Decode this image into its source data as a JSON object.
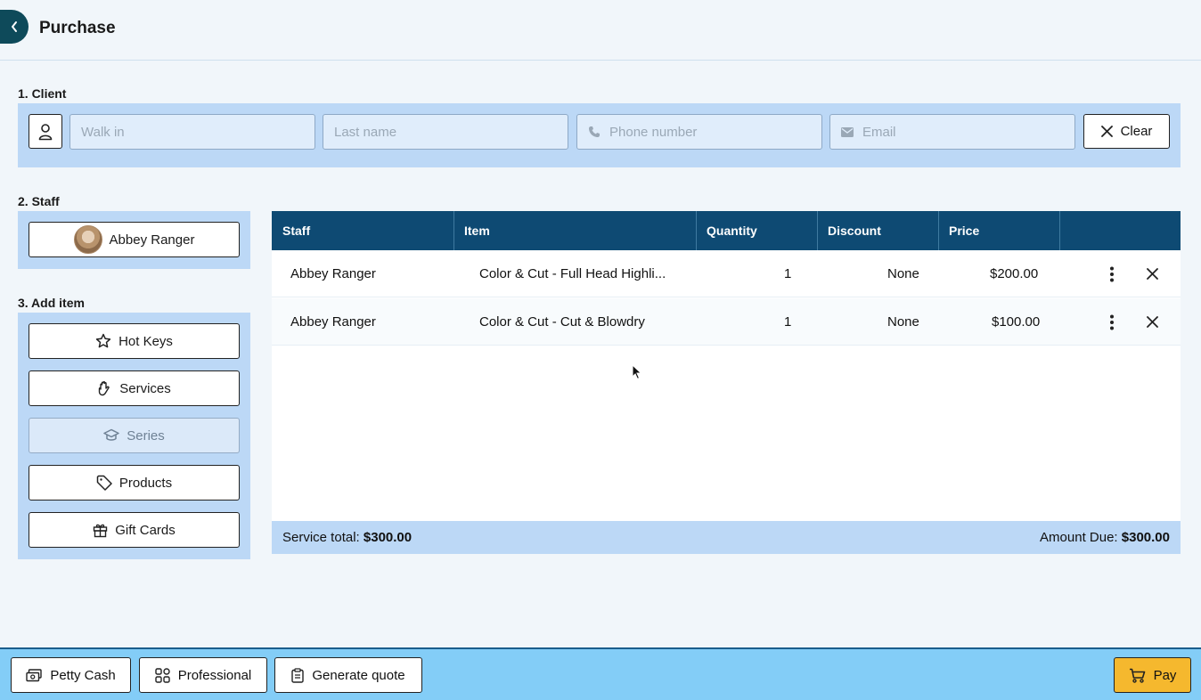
{
  "header": {
    "title": "Purchase"
  },
  "client": {
    "section_label": "1. Client",
    "first_name_value": "Walk in",
    "last_name_placeholder": "Last name",
    "phone_placeholder": "Phone number",
    "email_placeholder": "Email",
    "clear_label": "Clear"
  },
  "staff": {
    "section_label": "2. Staff",
    "selected_name": "Abbey Ranger"
  },
  "add_item": {
    "section_label": "3. Add item",
    "buttons": [
      {
        "label": "Hot Keys",
        "icon": "star-icon",
        "disabled": false
      },
      {
        "label": "Services",
        "icon": "hand-icon",
        "disabled": false
      },
      {
        "label": "Series",
        "icon": "graduation-cap-icon",
        "disabled": true
      },
      {
        "label": "Products",
        "icon": "tag-icon",
        "disabled": false
      },
      {
        "label": "Gift Cards",
        "icon": "gift-icon",
        "disabled": false
      }
    ]
  },
  "table": {
    "columns": [
      "Staff",
      "Item",
      "Quantity",
      "Discount",
      "Price",
      ""
    ],
    "rows": [
      {
        "staff": "Abbey Ranger",
        "item": "Color & Cut - Full Head Highli...",
        "quantity": "1",
        "discount": "None",
        "price": "$200.00"
      },
      {
        "staff": "Abbey Ranger",
        "item": "Color & Cut - Cut & Blowdry",
        "quantity": "1",
        "discount": "None",
        "price": "$100.00"
      }
    ]
  },
  "totals": {
    "service_total_label": "Service total:",
    "service_total_value": "$300.00",
    "amount_due_label": "Amount Due:",
    "amount_due_value": "$300.00"
  },
  "footer": {
    "petty_cash_label": "Petty Cash",
    "professional_label": "Professional",
    "generate_quote_label": "Generate quote",
    "pay_label": "Pay"
  },
  "colors": {
    "header_table": "#0e4a73",
    "panel": "#bcd8f6",
    "footer": "#83cdf7",
    "pay": "#f5b82e",
    "back_button": "#0e4a5a"
  }
}
